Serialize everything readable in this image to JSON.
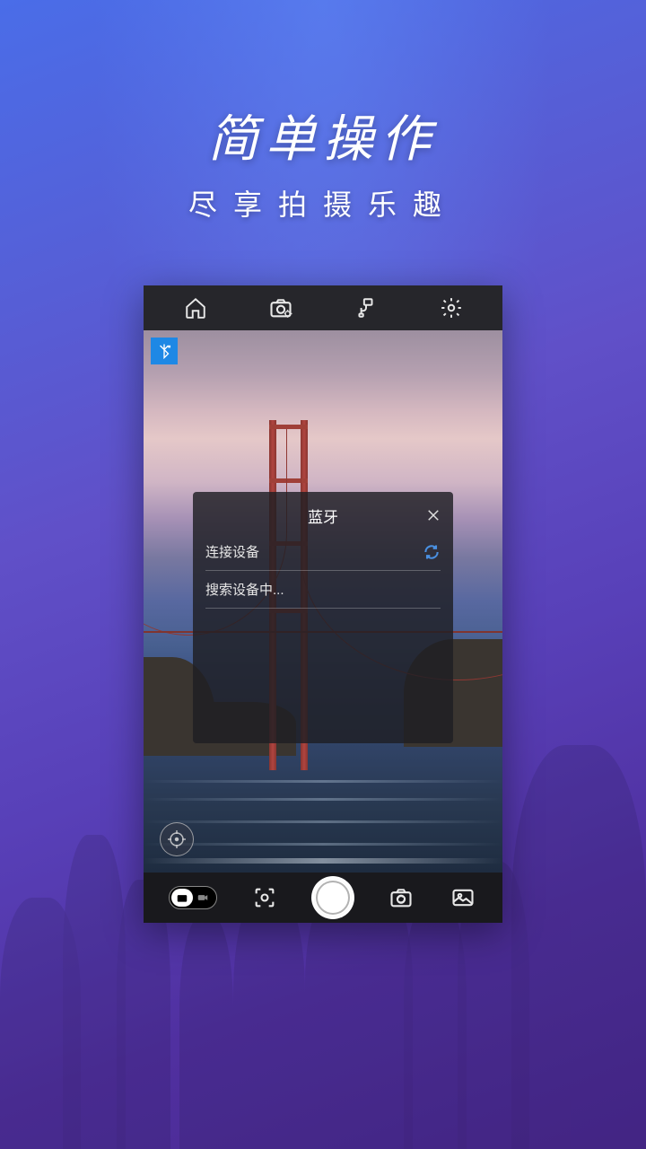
{
  "headline": {
    "main": "简单操作",
    "sub": "尽享拍摄乐趣"
  },
  "modal": {
    "title": "蓝牙",
    "connect_label": "连接设备",
    "searching_label": "搜索设备中..."
  },
  "icons": {
    "home": "home-icon",
    "camera_settings": "camera-settings-icon",
    "gimbal": "gimbal-icon",
    "settings": "settings-gear-icon",
    "bluetooth": "bluetooth-off-icon",
    "close": "close-icon",
    "refresh": "refresh-icon",
    "crosshair": "crosshair-target-icon",
    "photo_mode": "photo-mode-icon",
    "video_mode": "video-mode-icon",
    "focus": "focus-frame-icon",
    "shutter": "shutter-icon",
    "flip": "camera-flip-icon",
    "gallery": "gallery-icon"
  }
}
